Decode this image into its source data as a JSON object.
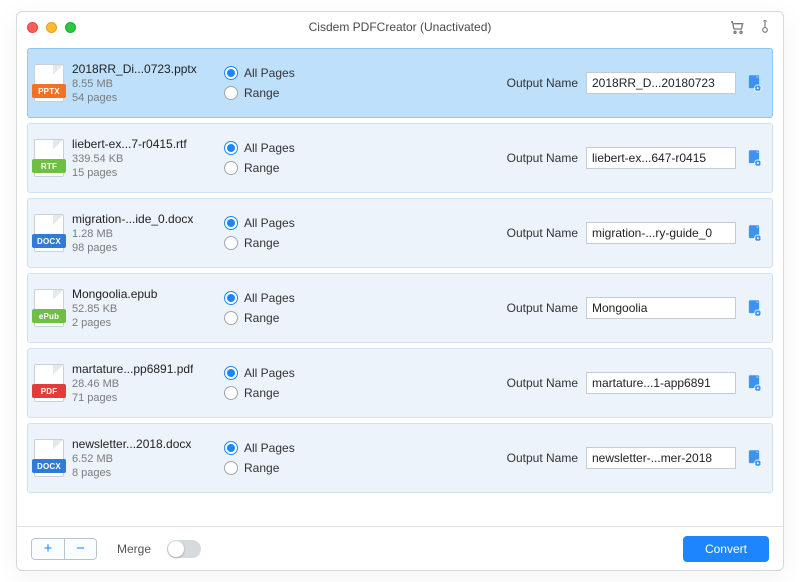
{
  "window": {
    "title": "Cisdem PDFCreator (Unactivated)"
  },
  "labels": {
    "allPages": "All Pages",
    "range": "Range",
    "outputName": "Output Name",
    "merge": "Merge",
    "convert": "Convert"
  },
  "colors": {
    "accent": "#1d86ff",
    "pptx": "#f37024",
    "rtf": "#6fbf44",
    "docx": "#2f7bd8",
    "epub": "#6fbf44",
    "pdf": "#e23c3c"
  },
  "files": [
    {
      "selected": true,
      "ext": "PPTX",
      "bandColor": "pptx",
      "name": "2018RR_Di...0723.pptx",
      "size": "8.55 MB",
      "pages": "54 pages",
      "output": "2018RR_D...20180723"
    },
    {
      "selected": false,
      "ext": "RTF",
      "bandColor": "rtf",
      "name": "liebert-ex...7-r0415.rtf",
      "size": "339.54 KB",
      "pages": "15 pages",
      "output": "liebert-ex...647-r0415"
    },
    {
      "selected": false,
      "ext": "DOCX",
      "bandColor": "docx",
      "name": "migration-...ide_0.docx",
      "size": "1.28 MB",
      "pages": "98 pages",
      "output": "migration-...ry-guide_0"
    },
    {
      "selected": false,
      "ext": "ePub",
      "bandColor": "epub",
      "name": "Mongoolia.epub",
      "size": "52.85 KB",
      "pages": "2 pages",
      "output": "Mongoolia"
    },
    {
      "selected": false,
      "ext": "PDF",
      "bandColor": "pdf",
      "name": "martature...pp6891.pdf",
      "size": "28.46 MB",
      "pages": "71 pages",
      "output": "martature...1-app6891"
    },
    {
      "selected": false,
      "ext": "DOCX",
      "bandColor": "docx",
      "name": "newsletter...2018.docx",
      "size": "6.52 MB",
      "pages": "8 pages",
      "output": "newsletter-...mer-2018"
    }
  ]
}
